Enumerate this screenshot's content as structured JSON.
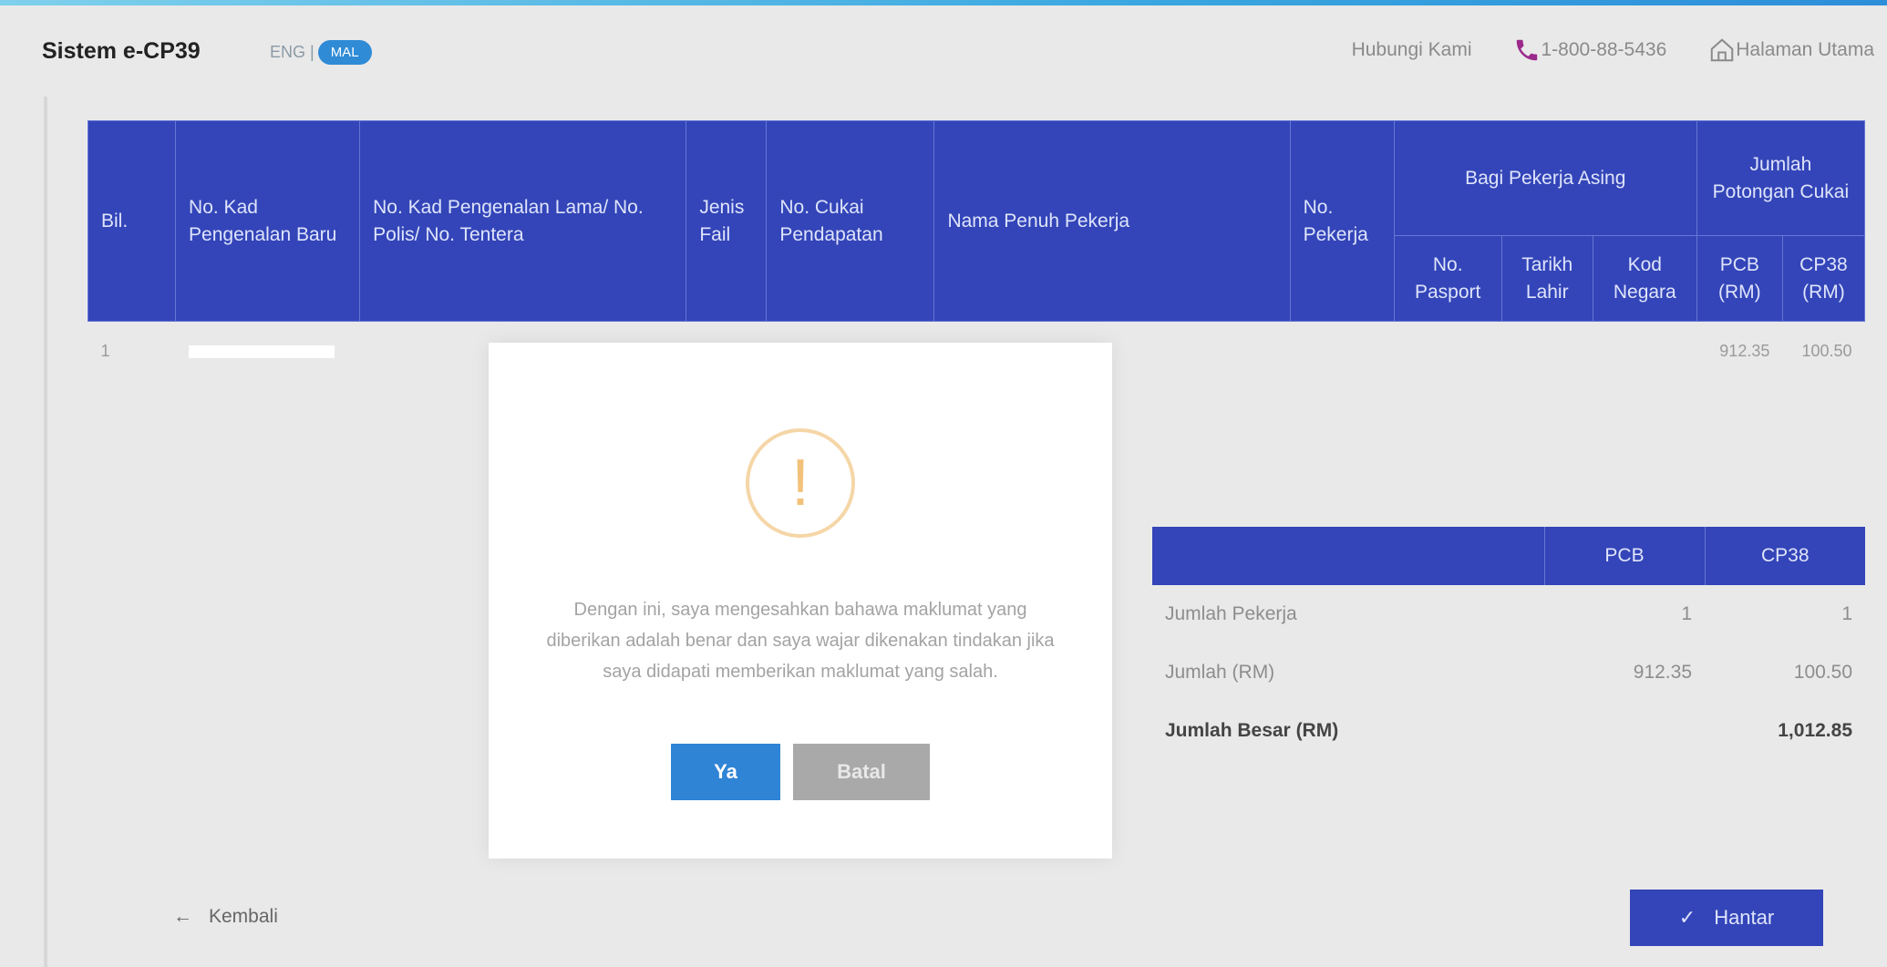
{
  "header": {
    "brand": "Sistem e-CP39",
    "lang_eng": "ENG |",
    "lang_mal": "MAL",
    "contact_label": "Hubungi Kami",
    "phone": "1-800-88-5436",
    "home_label": "Halaman Utama"
  },
  "table": {
    "headers": {
      "bil": "Bil.",
      "no_kad_baru": "No. Kad Pengenalan Baru",
      "no_kad_lama": "No. Kad Pengenalan Lama/ No. Polis/ No. Tentera",
      "jenis_fail": "Jenis Fail",
      "no_cukai": "No. Cukai Pendapatan",
      "nama": "Nama Penuh Pekerja",
      "no_pekerja": "No. Pekerja",
      "asing_group": "Bagi Pekerja Asing",
      "no_pasport": "No. Pasport",
      "tarikh_lahir": "Tarikh Lahir",
      "kod_negara": "Kod Negara",
      "jumlah_group": "Jumlah Potongan Cukai",
      "pcb": "PCB (RM)",
      "cp38": "CP38 (RM)"
    },
    "rows": [
      {
        "bil": "1",
        "nama_marker": "|",
        "pcb": "912.35",
        "cp38": "100.50"
      }
    ]
  },
  "summary": {
    "col_pcb": "PCB",
    "col_cp38": "CP38",
    "rows": [
      {
        "label": "Jumlah Pekerja",
        "pcb": "1",
        "cp38": "1"
      },
      {
        "label": "Jumlah (RM)",
        "pcb": "912.35",
        "cp38": "100.50"
      },
      {
        "label": "Jumlah Besar (RM)",
        "pcb": "",
        "cp38": "1,012.85"
      }
    ]
  },
  "footer": {
    "back_label": "Kembali",
    "submit_label": "Hantar"
  },
  "modal": {
    "icon_glyph": "!",
    "message": "Dengan ini, saya mengesahkan bahawa maklumat yang diberikan adalah benar dan saya wajar dikenakan tindakan jika saya didapati memberikan maklumat yang salah.",
    "yes_label": "Ya",
    "cancel_label": "Batal"
  },
  "colors": {
    "primary": "#3345b8",
    "button_blue": "#2f84d6",
    "warning": "#f3c27a",
    "phone_icon": "#9b2a8c"
  }
}
